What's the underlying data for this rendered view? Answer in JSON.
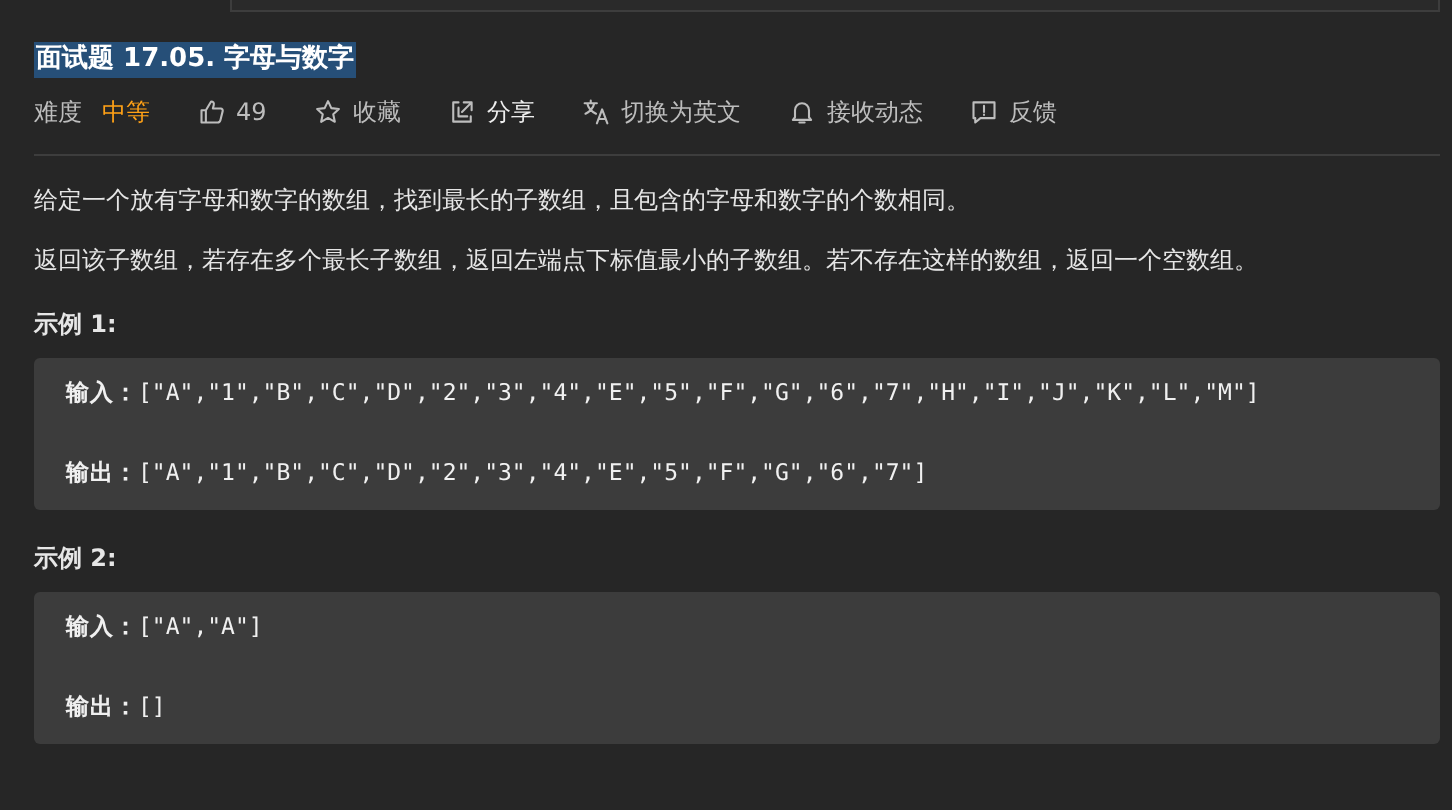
{
  "title": "面试题 17.05.  字母与数字",
  "meta": {
    "difficulty_label": "难度",
    "difficulty": "中等",
    "actions": [
      {
        "kind": "like",
        "label": "49"
      },
      {
        "kind": "star",
        "label": "收藏"
      },
      {
        "kind": "share",
        "label": "分享"
      },
      {
        "kind": "translate",
        "label": "切换为英文"
      },
      {
        "kind": "bell",
        "label": "接收动态"
      },
      {
        "kind": "feedback",
        "label": "反馈"
      }
    ]
  },
  "description": [
    "给定一个放有字母和数字的数组，找到最长的子数组，且包含的字母和数字的个数相同。",
    "返回该子数组，若存在多个最长子数组，返回左端点下标值最小的子数组。若不存在这样的数组，返回一个空数组。"
  ],
  "examples": [
    {
      "heading": "示例 1:",
      "lines": [
        "**输入：**[\"A\",\"1\",\"B\",\"C\",\"D\",\"2\",\"3\",\"4\",\"E\",\"5\",\"F\",\"G\",\"6\",\"7\",\"H\",\"I\",\"J\",\"K\",\"L\",\"M\"]",
        "**输出：**[\"A\",\"1\",\"B\",\"C\",\"D\",\"2\",\"3\",\"4\",\"E\",\"5\",\"F\",\"G\",\"6\",\"7\"]"
      ]
    },
    {
      "heading": "示例 2:",
      "lines": [
        "**输入：**[\"A\",\"A\"]",
        "**输出：**[]"
      ]
    }
  ]
}
